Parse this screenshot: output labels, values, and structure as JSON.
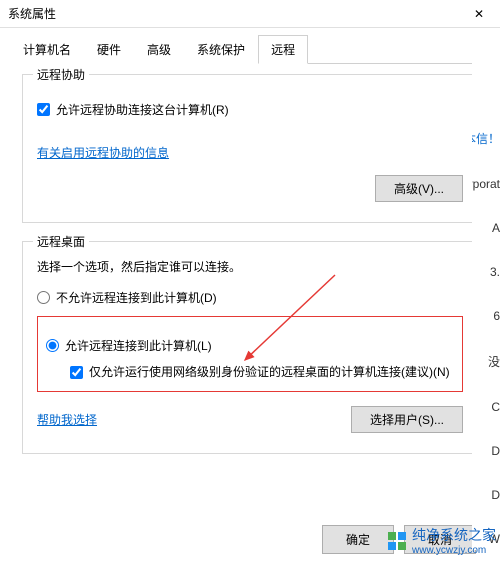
{
  "window": {
    "title": "系统属性"
  },
  "tabs": [
    {
      "label": "计算机名"
    },
    {
      "label": "硬件"
    },
    {
      "label": "高级"
    },
    {
      "label": "系统保护"
    },
    {
      "label": "远程"
    }
  ],
  "remote_assistance": {
    "title": "远程协助",
    "checkbox_label": "允许远程协助连接这台计算机(R)",
    "help_link": "有关启用远程协助的信息",
    "advanced_button": "高级(V)..."
  },
  "remote_desktop": {
    "title": "远程桌面",
    "description": "选择一个选项，然后指定谁可以连接。",
    "option_disallow": "不允许远程连接到此计算机(D)",
    "option_allow": "允许远程连接到此计算机(L)",
    "nla_checkbox": "仅允许运行使用网络级别身份验证的远程桌面的计算机连接(建议)(N)",
    "help_link": "帮助我选择",
    "select_users_button": "选择用户(S)..."
  },
  "dialog_buttons": {
    "ok": "确定",
    "cancel": "取消"
  },
  "side_fragments": {
    "f1": "本信！",
    "f2": "orporat",
    "f3": "A",
    "f4": "3.",
    "f5": "6",
    "f6": "没",
    "f7": "C",
    "f8": "D",
    "f9": "D",
    "f10": "W"
  },
  "watermark": {
    "brand": "纯净系统之家",
    "url": "www.ycwzjy.com"
  }
}
